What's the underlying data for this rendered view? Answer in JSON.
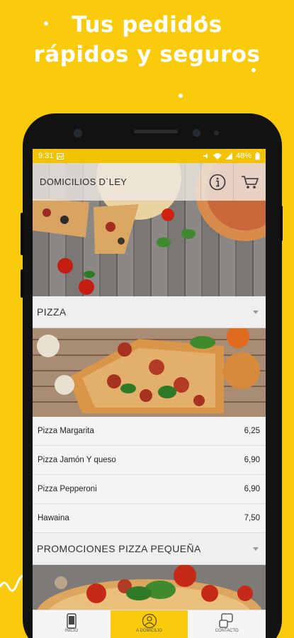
{
  "promo": {
    "headline_line1": "Tus pedidos",
    "headline_line2": "rápidos y seguros"
  },
  "status_bar": {
    "time": "9:31",
    "battery": "48%"
  },
  "app_bar": {
    "title": "DOMICILIOS D`LEY",
    "info_icon": "info-icon",
    "cart_icon": "cart-icon"
  },
  "sections": [
    {
      "title": "PIZZA",
      "items": [
        {
          "name": "Pizza Margarita",
          "price": "6,25"
        },
        {
          "name": "Pizza Jamón Y queso",
          "price": "6,90"
        },
        {
          "name": "Pizza Pepperoni",
          "price": "6,90"
        },
        {
          "name": "Hawaina",
          "price": "7,50"
        }
      ]
    },
    {
      "title": "PROMOCIONES PIZZA PEQUEÑA",
      "items": []
    }
  ],
  "bottom_nav": [
    {
      "label": "INICIO",
      "icon": "phone-icon",
      "active": false
    },
    {
      "label": "A DOMICILIO",
      "icon": "delivery-icon",
      "active": true
    },
    {
      "label": "CONTACTO",
      "icon": "contact-icon",
      "active": false
    }
  ],
  "colors": {
    "brand_yellow": "#F9CB0C",
    "status_bar": "#F3C206"
  }
}
